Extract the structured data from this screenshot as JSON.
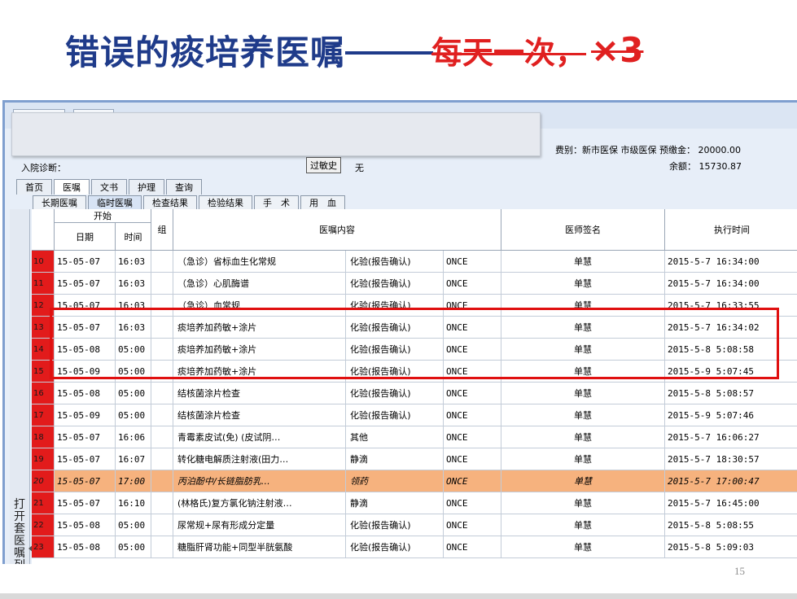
{
  "title": {
    "main": "错误的痰培养医嘱",
    "dash": "——",
    "wrong": "每天一次，",
    "times": "×3"
  },
  "patient": {
    "fee_line": "费别：新市医保 市级医保  预缴金： 20000.00",
    "balance_line": "余额：    15730.87",
    "diagnosis_label": "入院诊断：",
    "allergy_button": "过敏史",
    "allergy_value": "无"
  },
  "main_tabs": [
    "首页",
    "医嘱",
    "文书",
    "护理",
    "查询"
  ],
  "sub_tabs": [
    "长期医嘱",
    "临时医嘱",
    "检查结果",
    "检验结果",
    "手　术",
    "用　血"
  ],
  "side_panel_label": "打开套医嘱列表",
  "columns": {
    "start": "开始",
    "date": "日期",
    "time": "时间",
    "group": "组",
    "content": "医嘱内容",
    "doctor": "医师签名",
    "exec_time": "执行时间"
  },
  "rows": [
    {
      "no": "10",
      "date": "15-05-07",
      "time": "16:03",
      "content": "（急诊）省标血生化常规",
      "type": "化验(报告确认)",
      "freq": "ONCE",
      "doctor": "单慧",
      "exec": "2015-5-7 16:34:00"
    },
    {
      "no": "11",
      "date": "15-05-07",
      "time": "16:03",
      "content": "（急诊）心肌酶谱",
      "type": "化验(报告确认)",
      "freq": "ONCE",
      "doctor": "单慧",
      "exec": "2015-5-7 16:34:00"
    },
    {
      "no": "12",
      "date": "15-05-07",
      "time": "16:03",
      "content": "（急诊）血常规",
      "type": "化验(报告确认)",
      "freq": "ONCE",
      "doctor": "单慧",
      "exec": "2015-5-7 16:33:55"
    },
    {
      "no": "13",
      "date": "15-05-07",
      "time": "16:03",
      "content": "痰培养加药敏+涂片",
      "type": "化验(报告确认)",
      "freq": "ONCE",
      "doctor": "单慧",
      "exec": "2015-5-7 16:34:02"
    },
    {
      "no": "14",
      "date": "15-05-08",
      "time": "05:00",
      "content": "痰培养加药敏+涂片",
      "type": "化验(报告确认)",
      "freq": "ONCE",
      "doctor": "单慧",
      "exec": "2015-5-8 5:08:58"
    },
    {
      "no": "15",
      "date": "15-05-09",
      "time": "05:00",
      "content": "痰培养加药敏+涂片",
      "type": "化验(报告确认)",
      "freq": "ONCE",
      "doctor": "单慧",
      "exec": "2015-5-9 5:07:45"
    },
    {
      "no": "16",
      "date": "15-05-08",
      "time": "05:00",
      "content": "结核菌涂片检查",
      "type": "化验(报告确认)",
      "freq": "ONCE",
      "doctor": "单慧",
      "exec": "2015-5-8 5:08:57"
    },
    {
      "no": "17",
      "date": "15-05-09",
      "time": "05:00",
      "content": "结核菌涂片检查",
      "type": "化验(报告确认)",
      "freq": "ONCE",
      "doctor": "单慧",
      "exec": "2015-5-9 5:07:46"
    },
    {
      "no": "18",
      "date": "15-05-07",
      "time": "16:06",
      "content": "青霉素皮试(免) (皮试阴…",
      "type": "其他",
      "freq": "ONCE",
      "doctor": "单慧",
      "exec": "2015-5-7 16:06:27"
    },
    {
      "no": "19",
      "date": "15-05-07",
      "time": "16:07",
      "content": "转化糖电解质注射液(田力…",
      "type": "静滴",
      "freq": "ONCE",
      "doctor": "单慧",
      "exec": "2015-5-7 18:30:57"
    },
    {
      "no": "20",
      "date": "15-05-07",
      "time": "17:00",
      "content": "丙泊酚中/长链脂肪乳…",
      "type": "领药",
      "freq": "ONCE",
      "doctor": "单慧",
      "exec": "2015-5-7 17:00:47",
      "highlight": true
    },
    {
      "no": "21",
      "date": "15-05-07",
      "time": "16:10",
      "content": "(林格氏)复方氯化钠注射液…",
      "type": "静滴",
      "freq": "ONCE",
      "doctor": "单慧",
      "exec": "2015-5-7 16:45:00"
    },
    {
      "no": "22",
      "date": "15-05-08",
      "time": "05:00",
      "content": "尿常规+尿有形成分定量",
      "type": "化验(报告确认)",
      "freq": "ONCE",
      "doctor": "单慧",
      "exec": "2015-5-8 5:08:55"
    },
    {
      "no": "23",
      "date": "15-05-08",
      "time": "05:00",
      "content": "糖脂肝肾功能+同型半胱氨酸",
      "type": "化验(报告确认)",
      "freq": "ONCE",
      "doctor": "单慧",
      "exec": "2015-5-8 5:09:03"
    }
  ],
  "page_number": "15",
  "colors": {
    "title_blue": "#1f3b8a",
    "title_red": "#e02020",
    "row_number_red": "#e21b1b",
    "highlight_row": "#f6b27e",
    "annotation_box": "#e01010"
  }
}
